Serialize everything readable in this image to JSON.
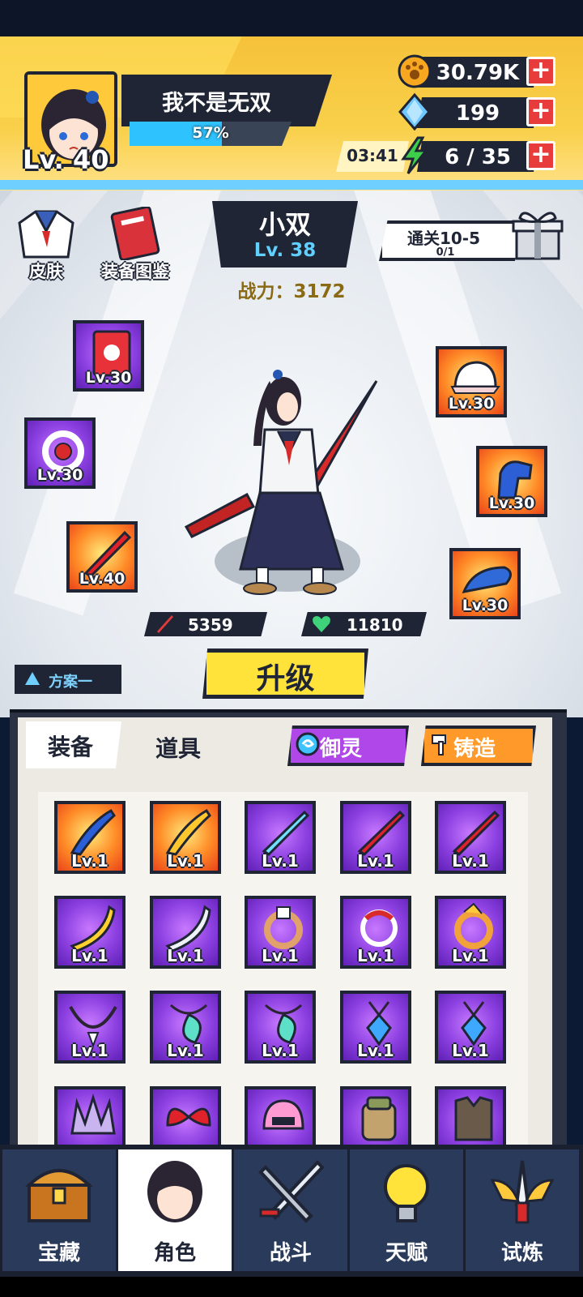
{
  "player": {
    "name": "我不是无双",
    "level": "Lv. 40",
    "xp_percent": "57%",
    "xp_fraction": 0.57
  },
  "resources": {
    "gold": "30.79K",
    "gems": "199",
    "energy_timer": "03:41",
    "energy": "6 / 35"
  },
  "side_menu": {
    "skins": "皮肤",
    "equipment_atlas": "装备图鉴"
  },
  "hero": {
    "name": "小双",
    "level": "Lv. 38",
    "power_label": "战力：",
    "power_value": "3172"
  },
  "quest": {
    "title": "通关10-5",
    "progress": "0/1"
  },
  "equipped": {
    "book": "Lv.30",
    "ring": "Lv.30",
    "weapon": "Lv.40",
    "hat": "Lv.30",
    "gloves": "Lv.30",
    "shoes": "Lv.30"
  },
  "stats": {
    "attack": "5359",
    "health": "11810"
  },
  "actions": {
    "upgrade": "升级",
    "plan": "方案一"
  },
  "inventory": {
    "tab_equipment": "装备",
    "tab_items": "道具",
    "spirit_button": "御灵",
    "forge_button": "铸造",
    "items": [
      {
        "lv": "Lv.1",
        "icon": "blade-icon",
        "rarity": "orange"
      },
      {
        "lv": "Lv.1",
        "icon": "golden-blade-icon",
        "rarity": "orange"
      },
      {
        "lv": "Lv.1",
        "icon": "laser-sword-icon",
        "rarity": "purple"
      },
      {
        "lv": "Lv.1",
        "icon": "red-sword-icon",
        "rarity": "purple"
      },
      {
        "lv": "Lv.1",
        "icon": "red-sword-icon",
        "rarity": "purple"
      },
      {
        "lv": "Lv.1",
        "icon": "banana-blade-icon",
        "rarity": "purple"
      },
      {
        "lv": "Lv.1",
        "icon": "silver-blade-icon",
        "rarity": "purple"
      },
      {
        "lv": "Lv.1",
        "icon": "ring-icon",
        "rarity": "purple"
      },
      {
        "lv": "Lv.1",
        "icon": "red-ring-icon",
        "rarity": "purple"
      },
      {
        "lv": "Lv.1",
        "icon": "dragon-ring-icon",
        "rarity": "purple"
      },
      {
        "lv": "Lv.1",
        "icon": "tooth-necklace-icon",
        "rarity": "purple"
      },
      {
        "lv": "Lv.1",
        "icon": "jade-pendant-icon",
        "rarity": "purple"
      },
      {
        "lv": "Lv.1",
        "icon": "jade-pendant-icon",
        "rarity": "purple"
      },
      {
        "lv": "Lv.1",
        "icon": "crystal-pendant-icon",
        "rarity": "purple"
      },
      {
        "lv": "Lv.1",
        "icon": "crystal-pendant-icon",
        "rarity": "purple"
      },
      {
        "lv": "",
        "icon": "spike-crown-icon",
        "rarity": "purple"
      },
      {
        "lv": "",
        "icon": "red-bow-icon",
        "rarity": "purple"
      },
      {
        "lv": "",
        "icon": "pink-helmet-icon",
        "rarity": "purple"
      },
      {
        "lv": "",
        "icon": "backpack-icon",
        "rarity": "purple"
      },
      {
        "lv": "",
        "icon": "armor-vest-icon",
        "rarity": "purple"
      }
    ]
  },
  "nav": {
    "treasure": "宝藏",
    "character": "角色",
    "battle": "战斗",
    "talent": "天赋",
    "trial": "试炼"
  },
  "colors": {
    "accent_yellow": "#f9d04a",
    "dark": "#1f2535",
    "epic_purple": "#8b3fe0",
    "legend_orange": "#ff8a26"
  }
}
